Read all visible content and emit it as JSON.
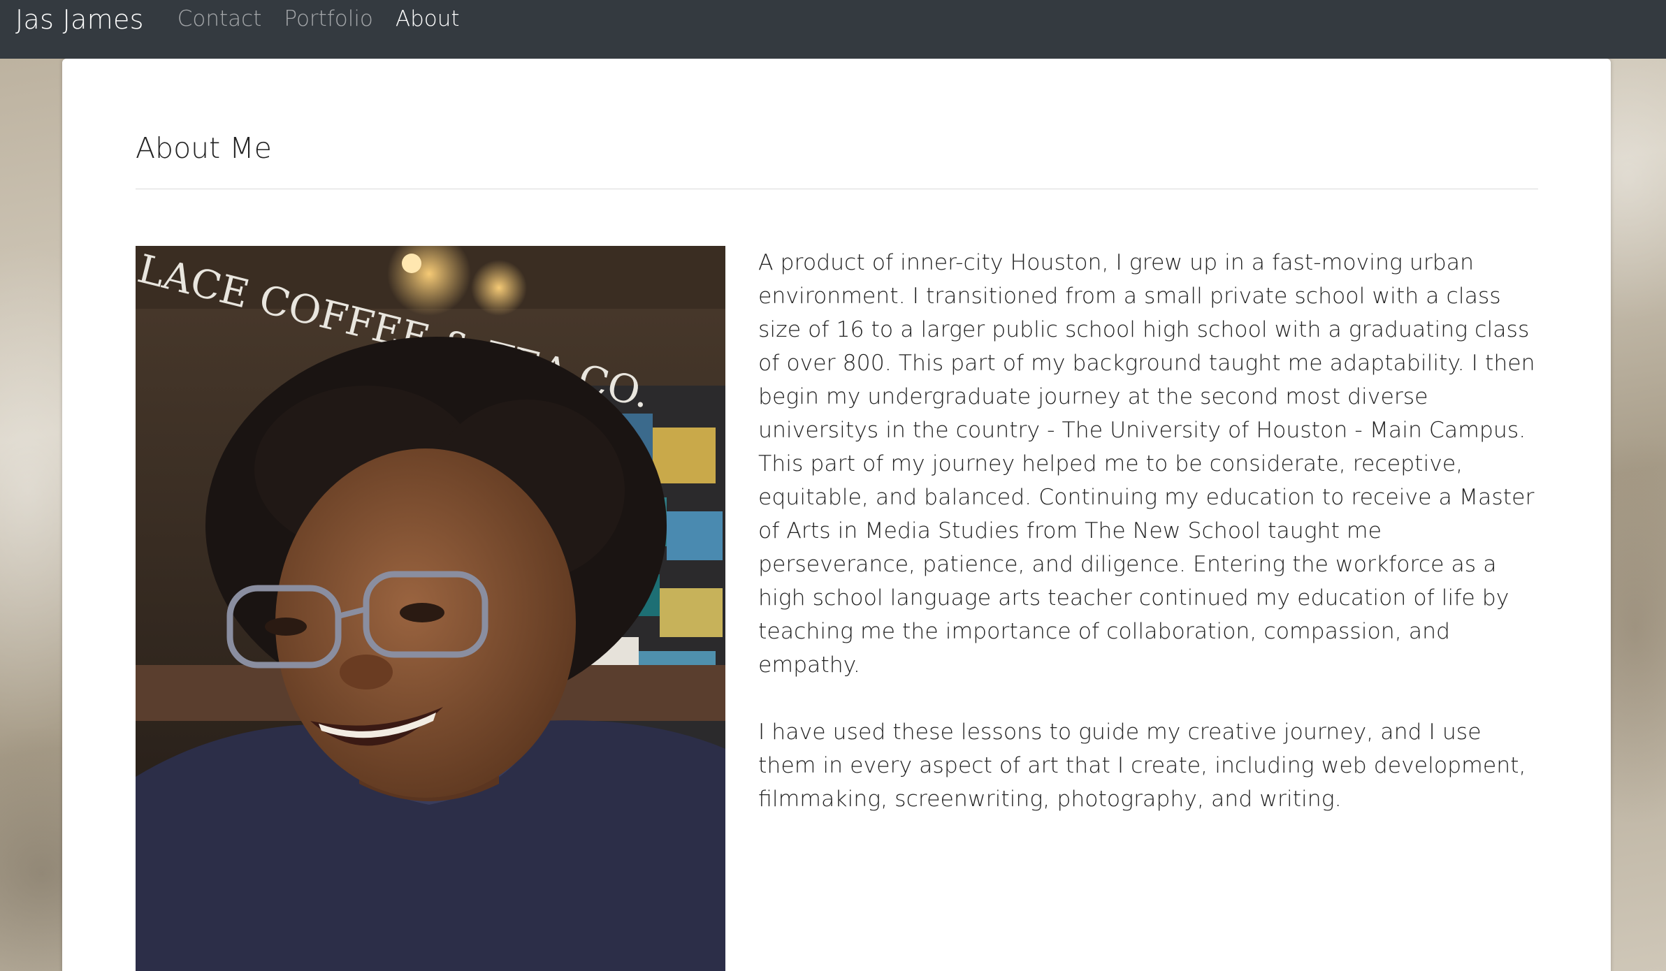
{
  "navbar": {
    "brand": "Jas James",
    "links": [
      {
        "label": "Contact",
        "active": false
      },
      {
        "label": "Portfolio",
        "active": false
      },
      {
        "label": "About",
        "active": true
      }
    ]
  },
  "main": {
    "title": "About Me",
    "photo": {
      "sign_text": "LACE COFFEE & TEA CO."
    },
    "paragraphs": [
      "A product of inner-city Houston, I grew up in a fast-moving urban environment. I transitioned from a small private school with a class size of 16 to a larger public school high school with a graduating class of over 800. This part of my background taught me adaptability. I then begin my undergraduate journey at the second most diverse universitys in the country - The University of Houston - Main Campus. This part of my journey helped me to be considerate, receptive, equitable, and balanced. Continuing my education to receive a Master of Arts in Media Studies from The New School taught me perseverance, patience, and diligence. Entering the workforce as a high school language arts teacher continued my education of life by teaching me the importance of collaboration, compassion, and empathy.",
      "I have used these lessons to guide my creative journey, and I use them in every aspect of art that I create, including web development, filmmaking, screenwriting, photography, and writing."
    ]
  },
  "colors": {
    "navbar_bg": "#343a40",
    "nav_active": "#ffffff",
    "nav_inactive": "rgba(255,255,255,0.55)",
    "card_bg": "#ffffff"
  }
}
